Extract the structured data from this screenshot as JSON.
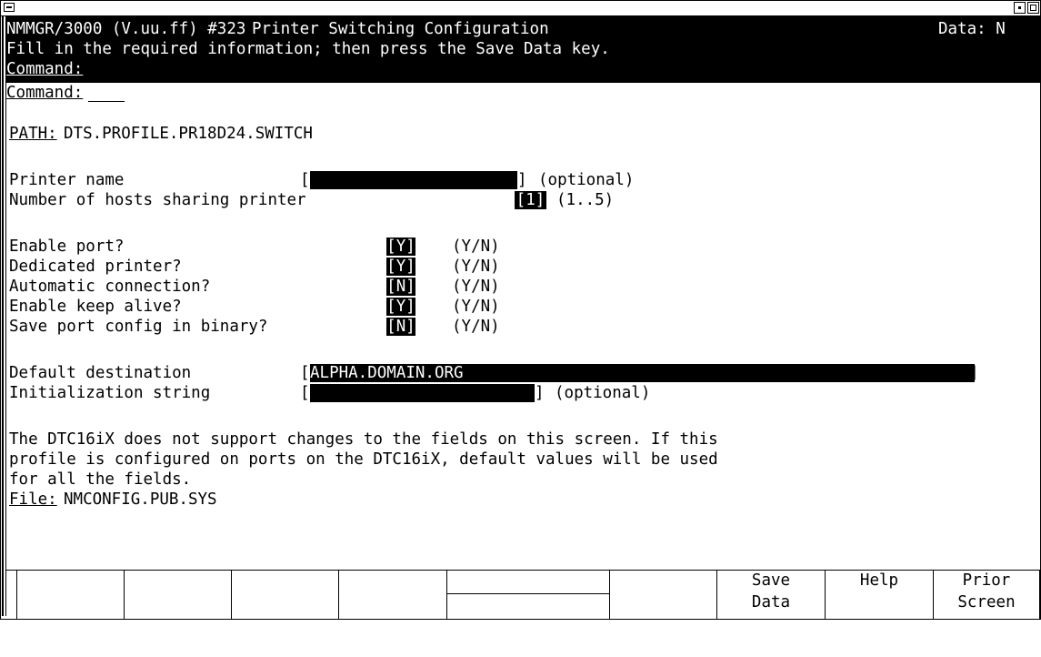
{
  "header": {
    "app": "NMMGR/3000 (V.uu.ff) #323",
    "screen_title": "Printer Switching Configuration",
    "data_flag": "Data: N",
    "instruction": "Fill in the required information; then press the Save Data key.",
    "command_label": "Command:"
  },
  "path": {
    "label": "PATH:",
    "value": "DTS.PROFILE.PR18D24.SWITCH"
  },
  "fields": {
    "printer_name": {
      "label": "Printer name",
      "value": "",
      "hint": "(optional)"
    },
    "num_hosts": {
      "label": "Number of hosts sharing printer",
      "value": "1",
      "hint": "(1..5)"
    },
    "enable_port": {
      "label": "Enable port?",
      "value": "Y",
      "hint": "(Y/N)"
    },
    "dedicated_printer": {
      "label": "Dedicated printer?",
      "value": "Y",
      "hint": "(Y/N)"
    },
    "automatic_connection": {
      "label": "Automatic connection?",
      "value": "N",
      "hint": "(Y/N)"
    },
    "enable_keep_alive": {
      "label": "Enable keep alive?",
      "value": "Y",
      "hint": "(Y/N)"
    },
    "save_port_config": {
      "label": "Save port config in binary?",
      "value": "N",
      "hint": "(Y/N)"
    },
    "default_destination": {
      "label": "Default destination",
      "value": "ALPHA.DOMAIN.ORG"
    },
    "init_string": {
      "label": "Initialization string",
      "value": "",
      "hint": "(optional)"
    }
  },
  "note": {
    "line1": "The DTC16iX does not support changes to the fields on this screen. If this",
    "line2": "profile is configured on ports on the DTC16iX, default values will be used",
    "line3": "for all the fields."
  },
  "file": {
    "label": "File:",
    "value": "NMCONFIG.PUB.SYS"
  },
  "function_keys": [
    {
      "line1": "",
      "line2": ""
    },
    {
      "line1": "",
      "line2": ""
    },
    {
      "line1": "",
      "line2": ""
    },
    {
      "line1": "",
      "line2": ""
    },
    {
      "line1": "",
      "line2": ""
    },
    {
      "line1": "",
      "line2": ""
    },
    {
      "line1": "Save",
      "line2": "Data"
    },
    {
      "line1": "Help",
      "line2": ""
    },
    {
      "line1": "Prior",
      "line2": "Screen"
    }
  ]
}
